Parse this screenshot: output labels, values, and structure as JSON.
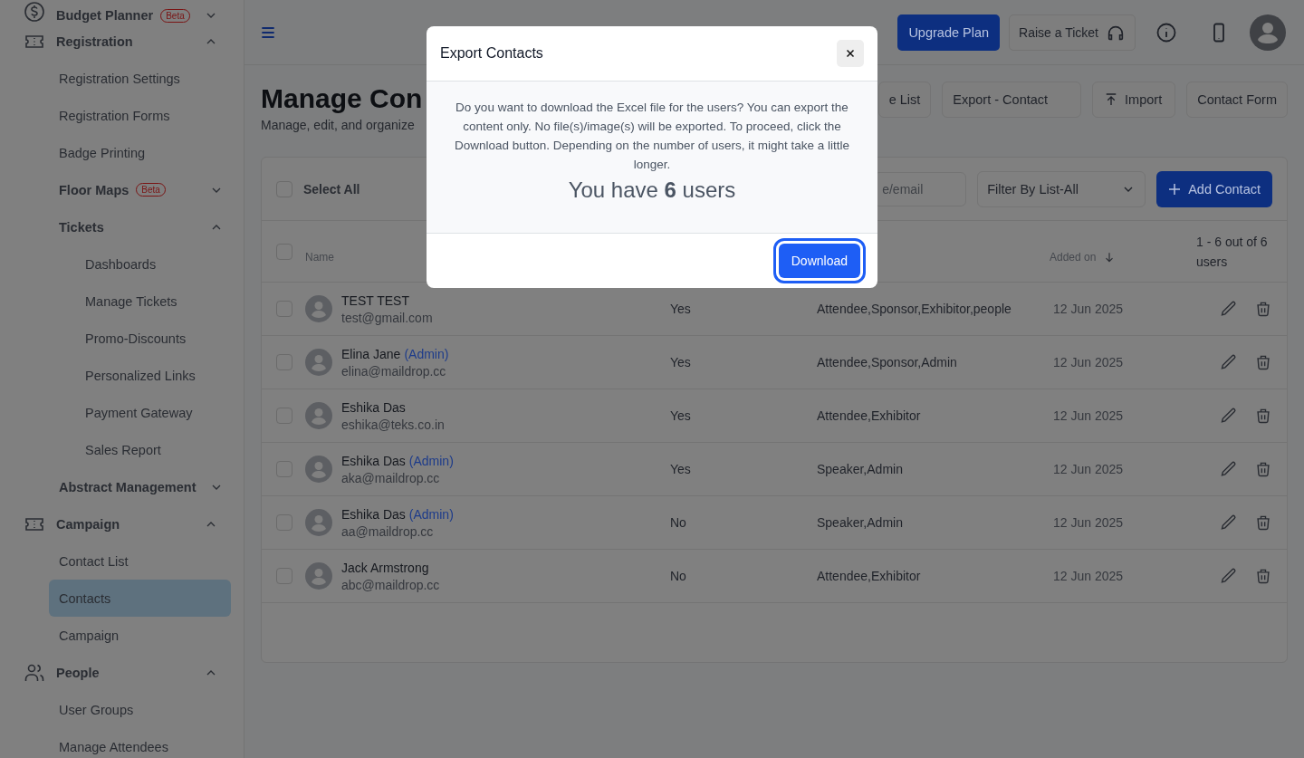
{
  "sidebar": {
    "items": [
      {
        "label": "Budget Planner",
        "badge": "Beta",
        "expanded": false,
        "selected": false
      },
      {
        "label": "Registration",
        "expanded": true,
        "selected": false,
        "children": [
          {
            "label": "Registration Settings",
            "selected": false
          },
          {
            "label": "Registration Forms",
            "selected": false
          },
          {
            "label": "Badge Printing",
            "selected": false
          },
          {
            "label": "Floor Maps",
            "badge": "Beta",
            "expanded": false,
            "selected": false
          },
          {
            "label": "Tickets",
            "expanded": true,
            "selected": false,
            "children": [
              {
                "label": "Dashboards",
                "selected": false
              },
              {
                "label": "Manage Tickets",
                "selected": false
              },
              {
                "label": "Promo-Discounts",
                "selected": false
              },
              {
                "label": "Personalized Links",
                "selected": false
              },
              {
                "label": "Payment Gateway",
                "selected": false
              },
              {
                "label": "Sales Report",
                "selected": false
              }
            ]
          },
          {
            "label": "Abstract Management",
            "expanded": false,
            "selected": false
          }
        ]
      },
      {
        "label": "Campaign",
        "expanded": true,
        "selected": false,
        "children": [
          {
            "label": "Contact List",
            "selected": false
          },
          {
            "label": "Contacts",
            "selected": true
          },
          {
            "label": "Campaign",
            "selected": false
          }
        ]
      },
      {
        "label": "People",
        "expanded": true,
        "selected": false,
        "children": [
          {
            "label": "User Groups",
            "selected": false
          },
          {
            "label": "Manage Attendees",
            "selected": false
          }
        ]
      }
    ]
  },
  "top_bar": {
    "upgrade_button": "Upgrade Plan",
    "ticket_button": "Raise a Ticket"
  },
  "page": {
    "title": "Manage Con",
    "subtitle": "Manage, edit, and organize",
    "actions": [
      {
        "label": "e List",
        "kind": "plain"
      },
      {
        "label": "Export - Contact",
        "kind": "plain"
      },
      {
        "label": "Import",
        "kind": "upload"
      },
      {
        "label": "Contact Form",
        "kind": "plain"
      }
    ]
  },
  "table": {
    "select_all": {
      "label": "Select All",
      "checked": false
    },
    "search": {
      "placeholder": "e/email"
    },
    "filter": {
      "value": "Filter By List-All"
    },
    "add_button": "Add Contact",
    "header_checkbox": {
      "checked": false
    },
    "columns": {
      "name": "Name",
      "added_on": "Added on",
      "count": "1 - 6 out of 6 users"
    },
    "rows": [
      {
        "name": "TEST TEST",
        "email": "test@gmail.com",
        "column_2": "Yes",
        "column_3": "Attendee,Sponsor,Exhibitor,people",
        "added_on": "12 Jun 2025",
        "checked": false
      },
      {
        "name": "Elina Jane",
        "tag": "(Admin)",
        "email": "elina@maildrop.cc",
        "column_2": "Yes",
        "column_3": "Attendee,Sponsor,Admin",
        "added_on": "12 Jun 2025",
        "checked": false
      },
      {
        "name": "Eshika Das",
        "email": "eshika@teks.co.in",
        "column_2": "Yes",
        "column_3": "Attendee,Exhibitor",
        "added_on": "12 Jun 2025",
        "checked": false
      },
      {
        "name": "Eshika Das",
        "tag": "(Admin)",
        "email": "aka@maildrop.cc",
        "column_2": "Yes",
        "column_3": "Speaker,Admin",
        "added_on": "12 Jun 2025",
        "checked": false
      },
      {
        "name": "Eshika Das",
        "tag": "(Admin)",
        "email": "aa@maildrop.cc",
        "column_2": "No",
        "column_3": "Speaker,Admin",
        "added_on": "12 Jun 2025",
        "checked": false
      },
      {
        "name": "Jack Armstrong",
        "email": "abc@maildrop.cc",
        "column_2": "No",
        "column_3": "Attendee,Exhibitor",
        "added_on": "12 Jun 2025",
        "checked": false
      }
    ]
  },
  "dialog": {
    "title": "Export Contacts",
    "message": "Do you want to download the Excel file for the users? You can export the content only. No file(s)/image(s) will be exported. To proceed, click the Download button. Depending on the number of users, it might take a little longer.",
    "count": "You have **6** users",
    "button": "Download"
  }
}
